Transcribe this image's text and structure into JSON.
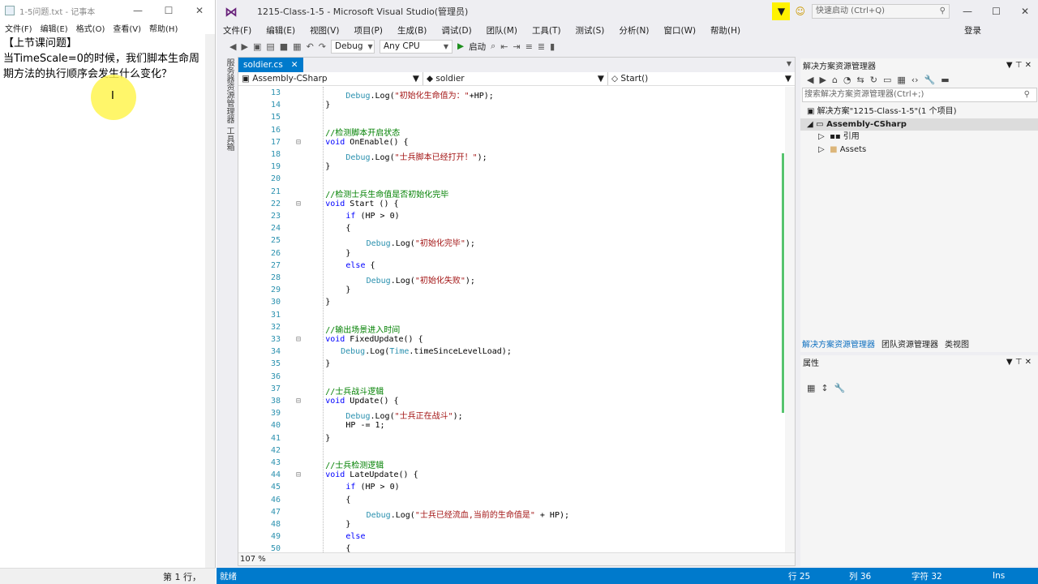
{
  "notepad": {
    "title": "1-5问题.txt - 记事本",
    "menu": [
      "文件(F)",
      "编辑(E)",
      "格式(O)",
      "查看(V)",
      "帮助(H)"
    ],
    "text": "【上节课问题】\n当TimeScale=0的时候，我们脚本生命周期方法的执行顺序会发生什么变化？",
    "status": "第 1 行，"
  },
  "vs": {
    "title": "1215-Class-1-5 - Microsoft Visual Studio(管理员)",
    "quick_launch": "快速启动 (Ctrl+Q)",
    "menu": [
      "文件(F)",
      "编辑(E)",
      "视图(V)",
      "项目(P)",
      "生成(B)",
      "调试(D)",
      "团队(M)",
      "工具(T)",
      "测试(S)",
      "分析(N)",
      "窗口(W)",
      "帮助(H)"
    ],
    "login": "登录",
    "toolbar": {
      "config": "Debug",
      "platform": "Any CPU",
      "start": "启动"
    },
    "side_tabs": [
      "服务器资源管理器",
      "工具箱"
    ],
    "tab": "soldier.cs",
    "nav": {
      "project": "Assembly-CSharp",
      "class": "soldier",
      "member": "Start()"
    },
    "zoom": "107 %",
    "code_lines": [
      {
        "n": 13,
        "indent": 8,
        "parts": [
          [
            "ty",
            "Debug"
          ],
          [
            "",
            "."
          ],
          [
            "",
            "Log("
          ],
          [
            "st",
            "\"初始化生命值为："
          ],
          [
            "st",
            "\""
          ],
          [
            "",
            "+HP);"
          ]
        ]
      },
      {
        "n": 14,
        "indent": 4,
        "parts": [
          [
            "",
            "}"
          ]
        ]
      },
      {
        "n": 15,
        "indent": 0,
        "parts": []
      },
      {
        "n": 16,
        "indent": 4,
        "parts": [
          [
            "cm",
            "//检测脚本开启状态"
          ]
        ]
      },
      {
        "n": 17,
        "indent": 4,
        "parts": [
          [
            "kw",
            "void"
          ],
          [
            "",
            " OnEnable() {"
          ]
        ]
      },
      {
        "n": 18,
        "indent": 8,
        "parts": [
          [
            "ty",
            "Debug"
          ],
          [
            "",
            ".Log("
          ],
          [
            "st",
            "\"士兵脚本已经打开！\""
          ],
          [
            "",
            ");"
          ]
        ]
      },
      {
        "n": 19,
        "indent": 4,
        "parts": [
          [
            "",
            "}"
          ]
        ]
      },
      {
        "n": 20,
        "indent": 0,
        "parts": []
      },
      {
        "n": 21,
        "indent": 4,
        "parts": [
          [
            "cm",
            "//检测士兵生命值是否初始化完毕"
          ]
        ]
      },
      {
        "n": 22,
        "indent": 4,
        "parts": [
          [
            "kw",
            "void"
          ],
          [
            "",
            " Start () {"
          ]
        ]
      },
      {
        "n": 23,
        "indent": 8,
        "parts": [
          [
            "kw",
            "if"
          ],
          [
            "",
            " (HP > 0)"
          ]
        ]
      },
      {
        "n": 24,
        "indent": 8,
        "parts": [
          [
            "",
            "{"
          ]
        ]
      },
      {
        "n": 25,
        "indent": 12,
        "parts": [
          [
            "ty",
            "Debug"
          ],
          [
            "",
            ".Log("
          ],
          [
            "st",
            "\"初始化完毕\""
          ],
          [
            "",
            ");"
          ]
        ]
      },
      {
        "n": 26,
        "indent": 8,
        "parts": [
          [
            "",
            "}"
          ]
        ]
      },
      {
        "n": 27,
        "indent": 8,
        "parts": [
          [
            "kw",
            "else"
          ],
          [
            "",
            " {"
          ]
        ]
      },
      {
        "n": 28,
        "indent": 12,
        "parts": [
          [
            "ty",
            "Debug"
          ],
          [
            "",
            ".Log("
          ],
          [
            "st",
            "\"初始化失败\""
          ],
          [
            "",
            ");"
          ]
        ]
      },
      {
        "n": 29,
        "indent": 8,
        "parts": [
          [
            "",
            "}"
          ]
        ]
      },
      {
        "n": 30,
        "indent": 4,
        "parts": [
          [
            "",
            "}"
          ]
        ]
      },
      {
        "n": 31,
        "indent": 0,
        "parts": []
      },
      {
        "n": 32,
        "indent": 4,
        "parts": [
          [
            "cm",
            "//输出场景进入时间"
          ]
        ]
      },
      {
        "n": 33,
        "indent": 4,
        "parts": [
          [
            "kw",
            "void"
          ],
          [
            "",
            " FixedUpdate() {"
          ]
        ]
      },
      {
        "n": 34,
        "indent": 7,
        "parts": [
          [
            "ty",
            "Debug"
          ],
          [
            "",
            ".Log("
          ],
          [
            "ty",
            "Time"
          ],
          [
            "",
            ".timeSinceLevelLoad);"
          ]
        ]
      },
      {
        "n": 35,
        "indent": 4,
        "parts": [
          [
            "",
            "}"
          ]
        ]
      },
      {
        "n": 36,
        "indent": 0,
        "parts": []
      },
      {
        "n": 37,
        "indent": 4,
        "parts": [
          [
            "cm",
            "//士兵战斗逻辑"
          ]
        ]
      },
      {
        "n": 38,
        "indent": 4,
        "parts": [
          [
            "kw",
            "void"
          ],
          [
            "",
            " Update() {"
          ]
        ]
      },
      {
        "n": 39,
        "indent": 8,
        "parts": [
          [
            "ty",
            "Debug"
          ],
          [
            "",
            ".Log("
          ],
          [
            "st",
            "\"士兵正在战斗\""
          ],
          [
            "",
            ");"
          ]
        ]
      },
      {
        "n": 40,
        "indent": 8,
        "parts": [
          [
            "",
            "HP -= 1;"
          ]
        ]
      },
      {
        "n": 41,
        "indent": 4,
        "parts": [
          [
            "",
            "}"
          ]
        ]
      },
      {
        "n": 42,
        "indent": 0,
        "parts": []
      },
      {
        "n": 43,
        "indent": 4,
        "parts": [
          [
            "cm",
            "//士兵检测逻辑"
          ]
        ]
      },
      {
        "n": 44,
        "indent": 4,
        "parts": [
          [
            "kw",
            "void"
          ],
          [
            "",
            " LateUpdate() {"
          ]
        ]
      },
      {
        "n": 45,
        "indent": 8,
        "parts": [
          [
            "kw",
            "if"
          ],
          [
            "",
            " (HP > 0)"
          ]
        ]
      },
      {
        "n": 46,
        "indent": 8,
        "parts": [
          [
            "",
            "{"
          ]
        ]
      },
      {
        "n": 47,
        "indent": 12,
        "parts": [
          [
            "ty",
            "Debug"
          ],
          [
            "",
            ".Log("
          ],
          [
            "st",
            "\"士兵已经流血,当前的生命值是\""
          ],
          [
            "",
            " + HP);"
          ]
        ]
      },
      {
        "n": 48,
        "indent": 8,
        "parts": [
          [
            "",
            "}"
          ]
        ]
      },
      {
        "n": 49,
        "indent": 8,
        "parts": [
          [
            "kw",
            "else"
          ]
        ]
      },
      {
        "n": 50,
        "indent": 8,
        "parts": [
          [
            "",
            "{"
          ]
        ]
      }
    ],
    "solution": {
      "title": "解决方案资源管理器",
      "search": "搜索解决方案资源管理器(Ctrl+;)",
      "items": [
        "解决方案\"1215-Class-1-5\"(1 个项目)",
        "Assembly-CSharp",
        "引用",
        "Assets"
      ],
      "tabs": [
        "解决方案资源管理器",
        "团队资源管理器",
        "类视图"
      ]
    },
    "properties": {
      "title": "属性"
    },
    "status": {
      "ready": "就绪",
      "row": "行 25",
      "col": "列 36",
      "ch": "字符 32",
      "ins": "Ins"
    }
  }
}
